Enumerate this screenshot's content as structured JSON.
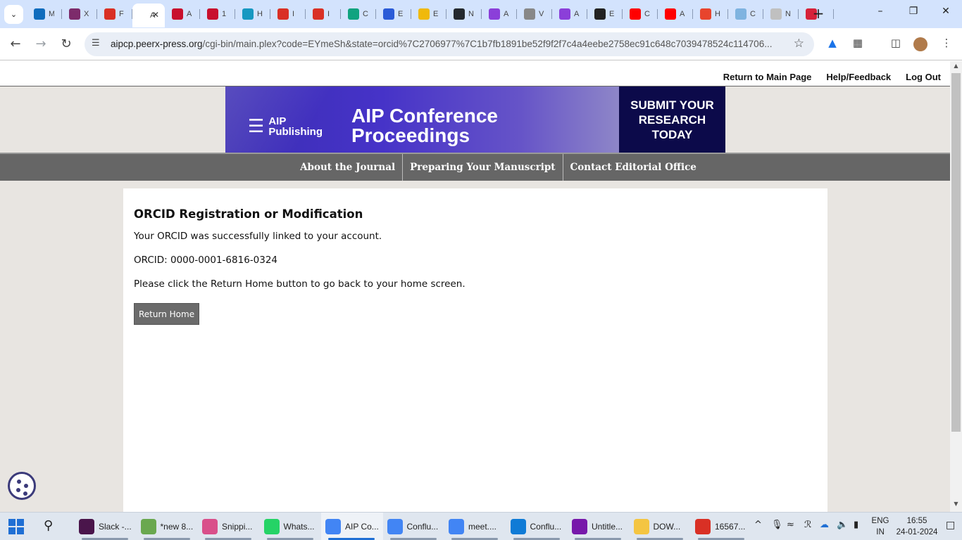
{
  "browser": {
    "tabs": [
      {
        "icon": "outlook-icon",
        "label": "M",
        "color": "#0f6cbd"
      },
      {
        "icon": "mask-icon",
        "label": "X",
        "color": "#7d2b6b"
      },
      {
        "icon": "gmail-icon",
        "label": "F",
        "color": "#d93025"
      },
      {
        "icon": "aip-icon",
        "label": "A",
        "color": "#ffffff",
        "active": true
      },
      {
        "icon": "flag-icon",
        "label": "A",
        "color": "#c8102e"
      },
      {
        "icon": "flag-icon",
        "label": "1",
        "color": "#c8102e"
      },
      {
        "icon": "salesforce-icon",
        "label": "H",
        "color": "#1798c1"
      },
      {
        "icon": "gmail-icon",
        "label": "I",
        "color": "#d93025"
      },
      {
        "icon": "gmail-icon",
        "label": "I",
        "color": "#d93025"
      },
      {
        "icon": "chatgpt-icon",
        "label": "C",
        "color": "#10a37f"
      },
      {
        "icon": "edge-icon",
        "label": "E",
        "color": "#2b5bd7"
      },
      {
        "icon": "binance-icon",
        "label": "E",
        "color": "#f0b90b"
      },
      {
        "icon": "github-icon",
        "label": "N",
        "color": "#24292f"
      },
      {
        "icon": "u-icon",
        "label": "A",
        "color": "#8b3fd9"
      },
      {
        "icon": "globe-icon",
        "label": "V",
        "color": "#888888"
      },
      {
        "icon": "u-icon",
        "label": "A",
        "color": "#8b3fd9"
      },
      {
        "icon": "chart-icon",
        "label": "E",
        "color": "#222222"
      },
      {
        "icon": "youtube-icon",
        "label": "C",
        "color": "#ff0000"
      },
      {
        "icon": "youtube-icon",
        "label": "A",
        "color": "#ff0000"
      },
      {
        "icon": "arrow-icon",
        "label": "H",
        "color": "#e8442d"
      },
      {
        "icon": "globe-icon",
        "label": "C",
        "color": "#7fb3e0"
      },
      {
        "icon": "n-icon",
        "label": "N",
        "color": "#c0c0c0"
      },
      {
        "icon": "record-icon",
        "label": "",
        "color": "#d6223a"
      }
    ],
    "url_host": "aipcp.peerx-press.org",
    "url_path": "/cgi-bin/main.plex?code=EYmeSh&state=orcid%7C2706977%7C1b7fb1891be52f9f2f7c4a4eebe2758ec91c648c7039478524c114706..."
  },
  "page": {
    "top_links": [
      "Return to Main Page",
      "Help/Feedback",
      "Log Out"
    ],
    "banner": {
      "publisher": "AIP\nPublishing",
      "title": "AIP Conference\nProceedings",
      "cta": "SUBMIT YOUR\nRESEARCH\nTODAY"
    },
    "nav": [
      "About the Journal",
      "Preparing Your Manuscript",
      "Contact Editorial Office"
    ],
    "heading": "ORCID Registration or Modification",
    "message": "Your ORCID was successfully linked to your account.",
    "orcid_line": "ORCID: 0000-0001-6816-0324",
    "instruction": "Please click the Return Home button to go back to your home screen.",
    "return_button": "Return Home"
  },
  "taskbar": {
    "apps": [
      {
        "label": "Slack -...",
        "icon": "slack-icon",
        "color": "#4a154b"
      },
      {
        "label": "*new 8...",
        "icon": "notepad-icon",
        "color": "#6aa84f"
      },
      {
        "label": "Snippi...",
        "icon": "snipping-icon",
        "color": "#d94f8a"
      },
      {
        "label": "Whats...",
        "icon": "whatsapp-icon",
        "color": "#25d366"
      },
      {
        "label": "AIP Co...",
        "icon": "chrome-icon",
        "color": "#4285f4",
        "active": true
      },
      {
        "label": "Conflu...",
        "icon": "chrome-icon",
        "color": "#4285f4"
      },
      {
        "label": "meet....",
        "icon": "chrome-icon",
        "color": "#4285f4"
      },
      {
        "label": "Conflu...",
        "icon": "edge-icon",
        "color": "#0f7bd6"
      },
      {
        "label": "Untitle...",
        "icon": "onenote-icon",
        "color": "#7719aa"
      },
      {
        "label": "DOW...",
        "icon": "folder-icon",
        "color": "#f4c542"
      },
      {
        "label": "16567...",
        "icon": "pdf-icon",
        "color": "#d93025"
      }
    ],
    "lang_line1": "ENG",
    "lang_line2": "IN",
    "time": "16:55",
    "date": "24-01-2024"
  }
}
